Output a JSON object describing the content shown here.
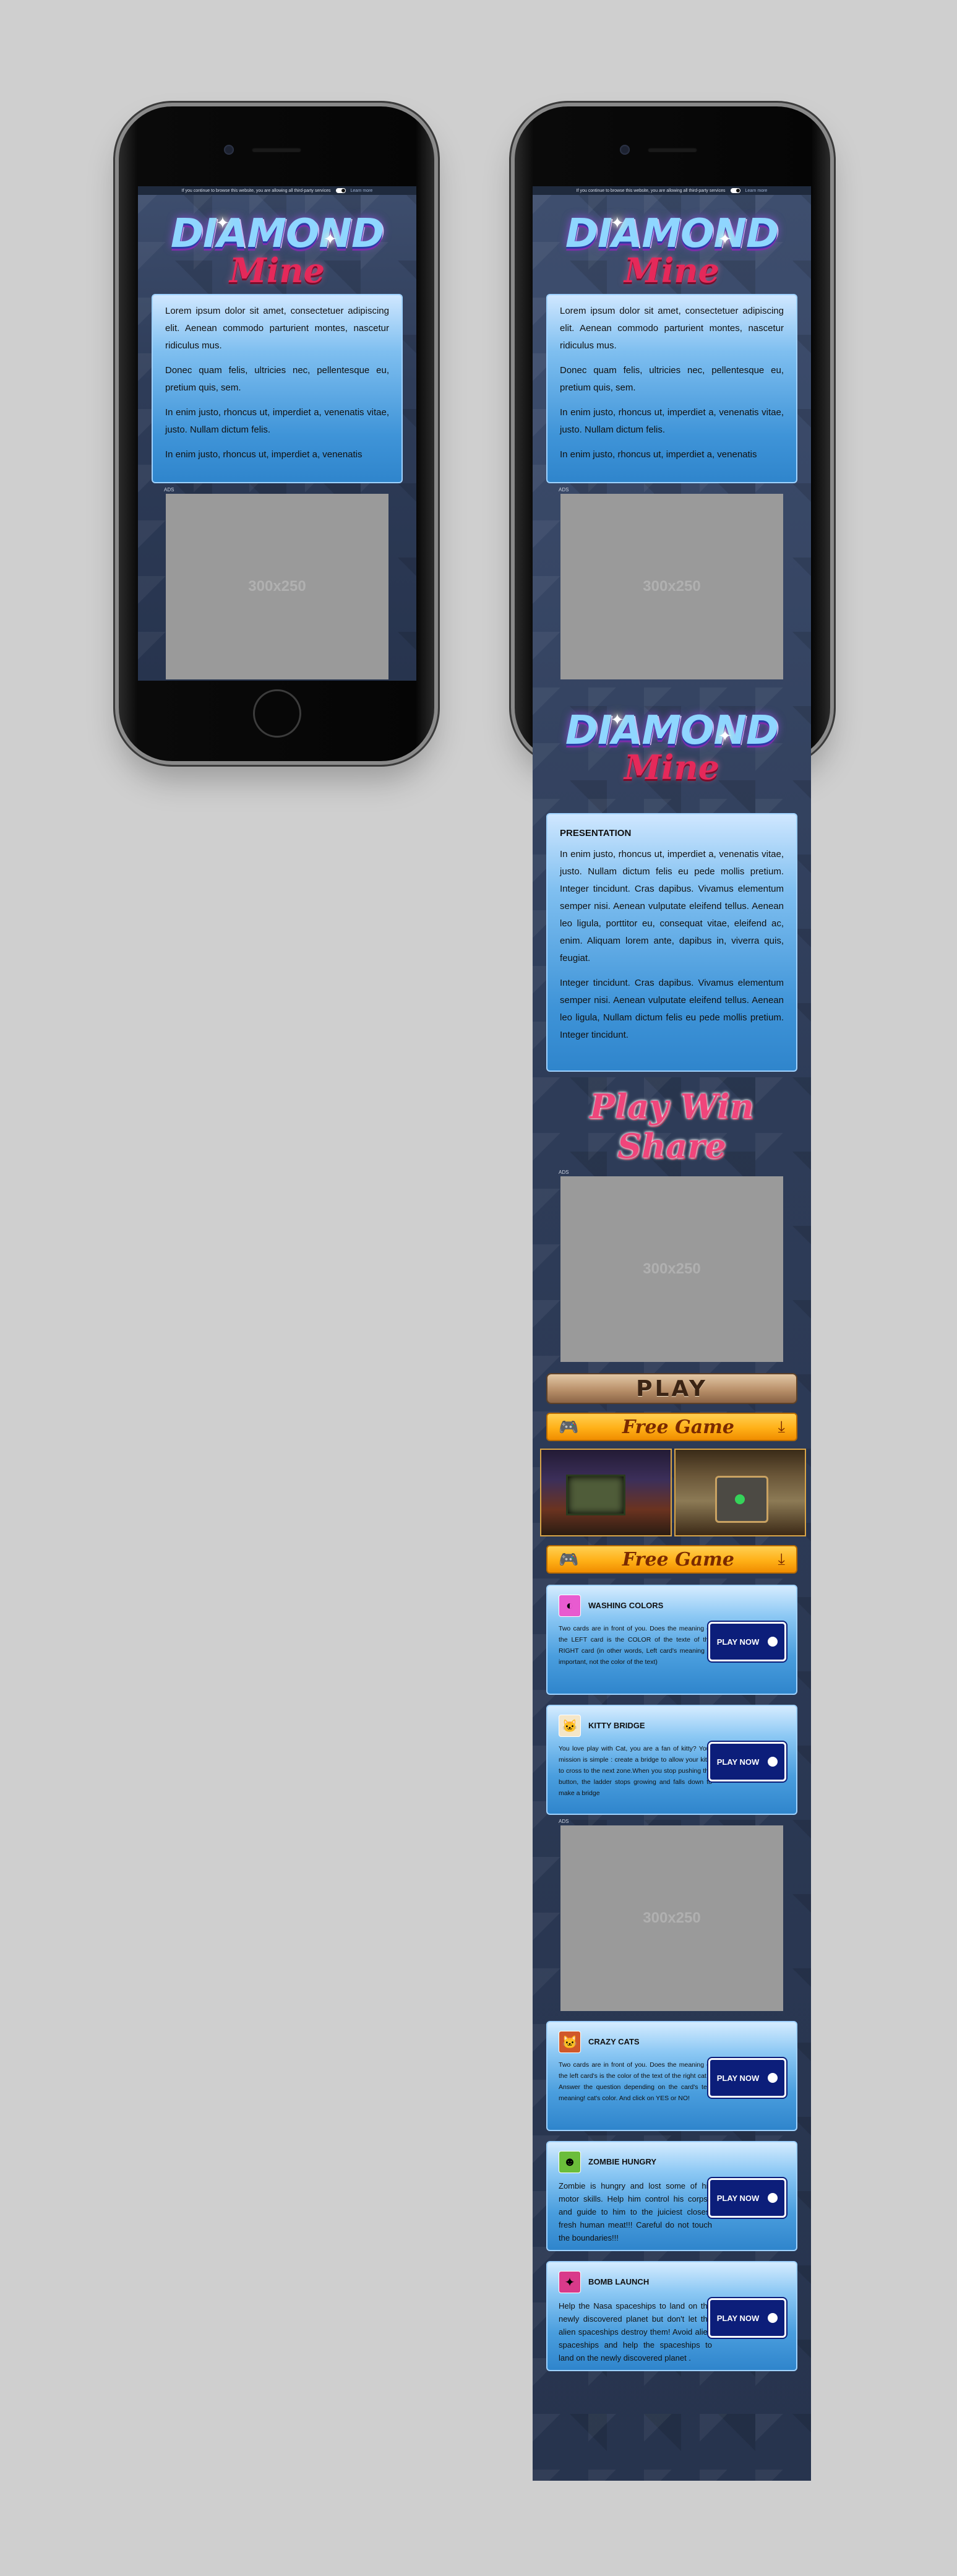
{
  "cookie": {
    "text": "If you continue to browse this website, you are allowing all third-party services",
    "more": "Learn more"
  },
  "logo": {
    "word": "DIAMOND",
    "sub": "Mine"
  },
  "intro": [
    "Lorem ipsum dolor sit amet, consectetuer adipiscing elit. Aenean commodo parturient montes, nascetur ridiculus mus.",
    "Donec quam felis, ultricies nec, pellentesque eu, pretium quis, sem.",
    "In enim justo, rhoncus ut, imperdiet a, venenatis vitae, justo. Nullam dictum felis.",
    "In enim justo, rhoncus ut, imperdiet a, venenatis"
  ],
  "ad": {
    "label": "ADS",
    "size": "300x250"
  },
  "presentation": {
    "title": "PRESENTATION",
    "p1": "In enim justo, rhoncus ut, imperdiet a, venenatis vitae, justo. Nullam dictum felis eu pede mollis pretium. Integer tincidunt. Cras dapibus. Vivamus elementum semper nisi. Aenean vulputate eleifend tellus. Aenean leo ligula, porttitor eu, consequat vitae, eleifend ac, enim. Aliquam lorem ante, dapibus in, viverra quis, feugiat.",
    "p2": "Integer tincidunt. Cras dapibus. Vivamus elementum semper nisi. Aenean vulputate eleifend tellus. Aenean leo ligula, Nullam dictum felis eu pede mollis pretium. Integer tincidunt."
  },
  "tagline": "Play Win Share",
  "buttons": {
    "play": "PLAY",
    "free_game": "Free Game",
    "play_now": "PLAY NOW"
  },
  "icons": {
    "gamepad": "gamepad-icon",
    "download": "download-icon"
  },
  "games": [
    {
      "name": "WASHING COLORS",
      "desc": "Two cards are in front of you. Does the meaning of the LEFT card is the COLOR of the texte of the RIGHT card (in other words, Left card's meaning is important, not the color of the text)",
      "thumb_color": "#e85bd0",
      "glyph": "◐"
    },
    {
      "name": "KITTY BRIDGE",
      "desc": "You love play with Cat, you are a fan of kitty? Your mission is simple : create a bridge to allow your kitty to cross to the next zone.When you stop pushing the button, the ladder stops growing and falls down to make a bridge",
      "thumb_color": "#f4e6c8",
      "glyph": "🐱"
    },
    {
      "name": "CRAZY CATS",
      "desc": "Two cards are in front of you. Does the meaning of the left card's is the color of the text of the right cat ? Answer the question depending on the card's text meaning! cat's color. And click on YES or NO!",
      "thumb_color": "#d0582a",
      "glyph": "🐱"
    },
    {
      "name": "ZOMBIE HUNGRY",
      "desc": "Zombie is hungry and lost some of his motor skills. Help him control his corpse and guide to him to the juiciest closest fresh human meat!!! Careful do not touch the boundaries!!!",
      "thumb_color": "#6bbd3a",
      "glyph": "☻"
    },
    {
      "name": "BOMB LAUNCH",
      "desc": "Help the Nasa spaceships to land on the newly discovered planet but don't let the alien spaceships destroy them! Avoid alien spaceships and help the spaceships to land on the newly discovered planet .",
      "thumb_color": "#d93a8a",
      "glyph": "✦"
    }
  ]
}
